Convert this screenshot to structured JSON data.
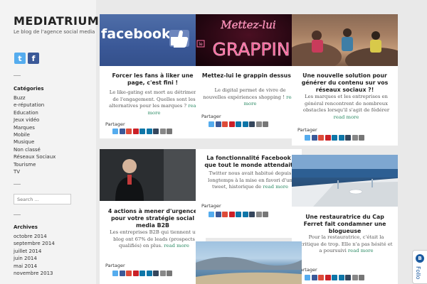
{
  "site": {
    "title": "MEDIATRIUM",
    "description": "Le blog de l'agence social media"
  },
  "social": [
    {
      "name": "twitter-icon",
      "glyph": "t",
      "color": "#55acee"
    },
    {
      "name": "facebook-icon",
      "glyph": "f",
      "color": "#3b5998"
    }
  ],
  "categories": {
    "title": "Catégories",
    "items": [
      "Buzz",
      "e-réputation",
      "Education",
      "Jeux vidéo",
      "Marques",
      "Mobile",
      "Musique",
      "Non classé",
      "Réseaux Sociaux",
      "Tourisme",
      "TV"
    ]
  },
  "search": {
    "placeholder": "Search ..."
  },
  "archives": {
    "title": "Archives",
    "items": [
      "octobre 2014",
      "septembre 2014",
      "juillet 2014",
      "juin 2014",
      "mai 2014",
      "novembre 2013"
    ]
  },
  "share_label": "Partager",
  "share_colors": [
    "#55acee",
    "#3b5998",
    "#dd4b39",
    "#cb2027",
    "#0e76a8",
    "#0e76a8",
    "#35465c",
    "#888888",
    "#777777"
  ],
  "read_more": "read more",
  "posts": [
    {
      "title": "Forcer les fans à liker une page, c'est fini !",
      "excerpt": "Le like-gating est mort au détriment de l'engagement. Quelles sont les alternatives pour les marques ? "
    },
    {
      "title": "Mettez-lui le grappin dessus !",
      "excerpt": "Le digital permet de vivre de nouvelles expériences shopping ! "
    },
    {
      "title": "Une nouvelle solution pour générer du contenu sur vos réseaux sociaux ?!",
      "excerpt": "Les marques et les entreprises en général rencontrent de nombreux obstacles lorsqu'il s'agit de fédérer "
    },
    {
      "title": "4 actions à mener d'urgence pour votre stratégie social media B2B",
      "excerpt": "Les entreprises B2B qui tiennent un blog ont 67% de leads (prospects qualifiés) en plus. "
    },
    {
      "title": "La fonctionnalité Facebook que tout le monde attendait",
      "excerpt": "Twitter nous avait habitué depuis longtemps à la mise en favori d'un tweet, historique de "
    },
    {
      "title": "Une restauratrice du Cap Ferret fait condamner une blogueuse",
      "excerpt": "Pour la restauratrice, c'était la critique de trop. Elle n'a pas hésité et a poursuivi "
    }
  ],
  "thumbs": {
    "facebook_logo_text": "facebook",
    "grappin_line1": "Mettez-lui",
    "grappin_line2": "GRAPPIN",
    "grappin_le": "le"
  },
  "follow": {
    "label": "Follo"
  }
}
